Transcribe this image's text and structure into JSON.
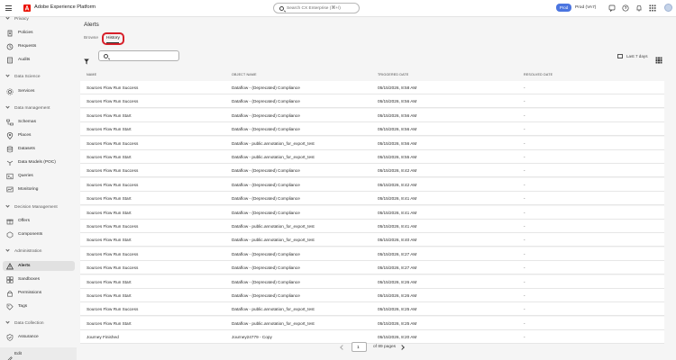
{
  "header": {
    "app_title": "Adobe Experience Platform",
    "search_placeholder": "Search CX Enterprise (⌘+/)",
    "env_badge": "Prod",
    "env_label": "Prod (VA7)"
  },
  "sidebar": {
    "sections": [
      {
        "label": "Privacy"
      },
      {
        "label": "Data Science"
      },
      {
        "label": "Data management"
      },
      {
        "label": "Decision Management"
      },
      {
        "label": "Administration"
      },
      {
        "label": "Data Collection"
      }
    ],
    "items": [
      {
        "label": "Policies",
        "icon": "policies-icon"
      },
      {
        "label": "Requests",
        "icon": "requests-icon"
      },
      {
        "label": "Audits",
        "icon": "audits-icon"
      },
      {
        "label": "Services",
        "icon": "services-icon"
      },
      {
        "label": "Schemas",
        "icon": "schemas-icon"
      },
      {
        "label": "Places",
        "icon": "places-icon"
      },
      {
        "label": "Datasets",
        "icon": "datasets-icon"
      },
      {
        "label": "Data Models (POC)",
        "icon": "data-models-icon"
      },
      {
        "label": "Queries",
        "icon": "queries-icon"
      },
      {
        "label": "Monitoring",
        "icon": "monitoring-icon"
      },
      {
        "label": "Offers",
        "icon": "offers-icon"
      },
      {
        "label": "Components",
        "icon": "components-icon"
      },
      {
        "label": "Alerts",
        "icon": "alerts-icon",
        "active": true
      },
      {
        "label": "Sandboxes",
        "icon": "sandboxes-icon"
      },
      {
        "label": "Permissions",
        "icon": "permissions-icon"
      },
      {
        "label": "Tags",
        "icon": "tags-icon"
      },
      {
        "label": "Assurance",
        "icon": "assurance-icon"
      }
    ],
    "edit_label": "Edit"
  },
  "page": {
    "title": "Alerts",
    "tabs": [
      {
        "label": "Browse"
      },
      {
        "label": "History",
        "active": true
      }
    ],
    "date_range": "Last 7 days"
  },
  "table": {
    "columns": [
      "NAME",
      "OBJECT NAME",
      "TRIGGERED DATE",
      "RESOLVED DATE"
    ],
    "rows": [
      [
        "Sources Flow Run Success",
        "Dataflow - (Deprecated) Compliance",
        "05/15/2026, 8:58 AM",
        "-"
      ],
      [
        "Sources Flow Run Success",
        "Dataflow - (Deprecated) Compliance",
        "05/15/2026, 8:56 AM",
        "-"
      ],
      [
        "Sources Flow Run Start",
        "Dataflow - (Deprecated) Compliance",
        "05/15/2026, 8:56 AM",
        "-"
      ],
      [
        "Sources Flow Run Start",
        "Dataflow - (Deprecated) Compliance",
        "05/15/2026, 8:56 AM",
        "-"
      ],
      [
        "Sources Flow Run Success",
        "Dataflow - public.annotation_for_export_test",
        "05/15/2026, 8:56 AM",
        "-"
      ],
      [
        "Sources Flow Run Start",
        "Dataflow - public.annotation_for_export_test",
        "05/15/2026, 8:55 AM",
        "-"
      ],
      [
        "Sources Flow Run Success",
        "Dataflow - (Deprecated) Compliance",
        "05/15/2026, 8:42 AM",
        "-"
      ],
      [
        "Sources Flow Run Success",
        "Dataflow - (Deprecated) Compliance",
        "05/15/2026, 8:42 AM",
        "-"
      ],
      [
        "Sources Flow Run Start",
        "Dataflow - (Deprecated) Compliance",
        "05/15/2026, 8:41 AM",
        "-"
      ],
      [
        "Sources Flow Run Start",
        "Dataflow - (Deprecated) Compliance",
        "05/15/2026, 8:41 AM",
        "-"
      ],
      [
        "Sources Flow Run Success",
        "Dataflow - public.annotation_for_export_test",
        "05/15/2026, 8:41 AM",
        "-"
      ],
      [
        "Sources Flow Run Start",
        "Dataflow - public.annotation_for_export_test",
        "05/15/2026, 8:40 AM",
        "-"
      ],
      [
        "Sources Flow Run Success",
        "Dataflow - (Deprecated) Compliance",
        "05/15/2026, 8:27 AM",
        "-"
      ],
      [
        "Sources Flow Run Success",
        "Dataflow - (Deprecated) Compliance",
        "05/15/2026, 8:27 AM",
        "-"
      ],
      [
        "Sources Flow Run Start",
        "Dataflow - (Deprecated) Compliance",
        "05/15/2026, 8:26 AM",
        "-"
      ],
      [
        "Sources Flow Run Start",
        "Dataflow - (Deprecated) Compliance",
        "05/15/2026, 8:26 AM",
        "-"
      ],
      [
        "Sources Flow Run Success",
        "Dataflow - public.annotation_for_export_test",
        "05/15/2026, 8:25 AM",
        "-"
      ],
      [
        "Sources Flow Run Start",
        "Dataflow - public.annotation_for_export_test",
        "05/15/2026, 8:25 AM",
        "-"
      ],
      [
        "Journey Finished",
        "Journey24779 - Copy",
        "05/15/2026, 8:20 AM",
        "-"
      ]
    ]
  },
  "pagination": {
    "current_page": "1",
    "of_pages": "of 89 pages"
  },
  "colors": {
    "accent": "#4b75e0",
    "brand": "#eb1000",
    "highlight": "#d7202a"
  }
}
